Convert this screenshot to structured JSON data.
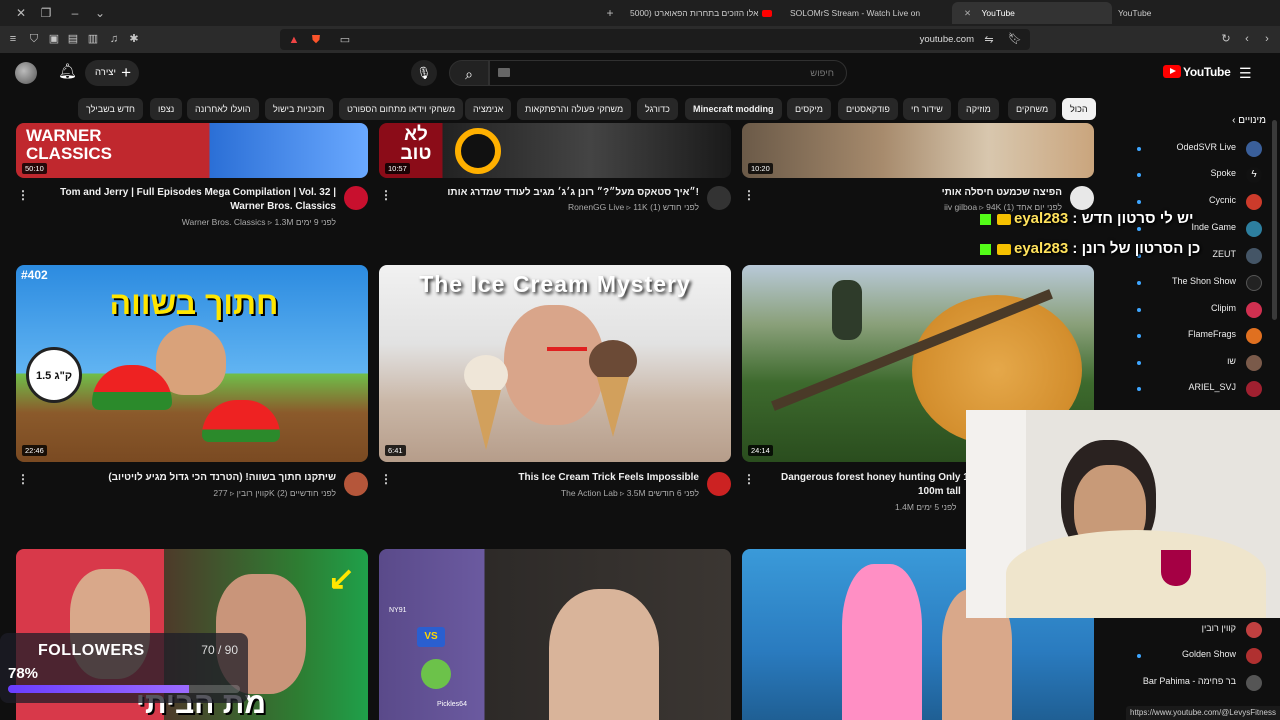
{
  "browser": {
    "tabs": [
      {
        "label": "אלו הזוכים בתחרות הפאוארט (5000"
      },
      {
        "label": "SOLOMrS Stream - Watch Live on"
      },
      {
        "label": "YouTube"
      },
      {
        "label": "YouTube"
      }
    ],
    "url": "youtube.com"
  },
  "header": {
    "create_label": "יצירה",
    "search_placeholder": "חיפוש",
    "logo_text": "YouTube"
  },
  "chips": [
    "הכול",
    "משחקים",
    "מוזיקה",
    "שידור חי",
    "פודקאסטים",
    "מיקסים",
    "Minecraft modding",
    "כדורגל",
    "משחקי פעולה והרפתקאות",
    "אנימציה",
    "משחקי וידאו מתחום הספורט",
    "תוכניות בישול",
    "הועלו לאחרונה",
    "נצפו",
    "חדש בשבילך"
  ],
  "videos": [
    {
      "title_l1": "Tom and Jerry | Full Episodes Mega Compilation | Vol. 32 |",
      "title_l2": "Warner Bros. Classics",
      "channel": "Warner Bros. Classics",
      "views": "1.3M",
      "age": "לפני 9 ימים",
      "duration": "50:10",
      "thumb_text": "WARNER CLASSICS"
    },
    {
      "title_l1": "״איך סטאקס מעל״?״ רונן ג׳ג׳ מגיב לעודד שמדרג אותו!",
      "channel": "RonenGG Live",
      "views": "11K",
      "age": "לפני חודש (1)",
      "duration": "10:57",
      "thumb_text": "לא טוב"
    },
    {
      "title_l1": "הפיצה שכמעט חיסלה אותי",
      "channel": "iiv gilboa",
      "views": "94K",
      "age": "לפני יום אחד (1)",
      "duration": "10:20"
    },
    {
      "title_l1": "שיתקנו חתוך בשווה! (הטרנד הכי גדול מגיע לויטיוב)",
      "channel": "קווין רובין",
      "views": "277K",
      "age": "לפני חודשיים (2)",
      "duration": "22:46",
      "thumb_text": "חתוך בשווה",
      "episode": "#402",
      "scale_label": "1.5 ק\"ג"
    },
    {
      "title_l1": "This Ice Cream Trick Feels Impossible",
      "channel": "The Action Lab",
      "views": "3.5M",
      "age": "לפני 6 חודשים",
      "duration": "6:41",
      "thumb_text": "The Ice Cream Mystery"
    },
    {
      "title_l1": "Dangerous forest honey hunting  Only 1",
      "title_l2": "100m tall",
      "views": "1.4M",
      "age": "לפני 5 ימים",
      "duration": "24:14"
    },
    {
      "thumb_text": "מת הביתי",
      "vs_label": "VS",
      "player_top": "NY91",
      "player_bottom": "Pickles64"
    }
  ],
  "sidebar": {
    "heading": "מינויים",
    "items": [
      {
        "name": "OdedSVR Live",
        "color": "#3a5f9a"
      },
      {
        "name": "Spoke",
        "color": "#111111"
      },
      {
        "name": "Cycnic",
        "color": "#cc3b2b"
      },
      {
        "name": "Inde Game",
        "color": "#2d7f9f"
      },
      {
        "name": "ZEUT",
        "color": "#445566"
      },
      {
        "name": "The Shon Show",
        "color": "#222222"
      },
      {
        "name": "Clipim",
        "color": "#d03050"
      },
      {
        "name": "FlameFrags",
        "color": "#e07020"
      },
      {
        "name": "שו",
        "color": "#7a5a4a"
      },
      {
        "name": "ARIEL_SVJ",
        "color": "#a02030"
      },
      {
        "name": "קווין רובין",
        "color": "#c04040"
      },
      {
        "name": "Golden Show",
        "color": "#b03030"
      },
      {
        "name": "Bar Pahima - בר פחימה",
        "color": "#555555"
      }
    ]
  },
  "overlay": {
    "chat": [
      {
        "user": "eyal283",
        "message": "יש לי סרטון חדש"
      },
      {
        "user": "eyal283",
        "message": "כן הסרטון של רונן"
      }
    ],
    "followers_label": "FOLLOWERS",
    "followers_count": "70 / 90",
    "followers_percent": "78%",
    "followers_progress": 0.78
  },
  "status_url": "https://www.youtube.com/@LevysFitness",
  "colors": {
    "accent": "#ff0000",
    "kick": "#53fc18",
    "progress": "#7b4dff"
  }
}
